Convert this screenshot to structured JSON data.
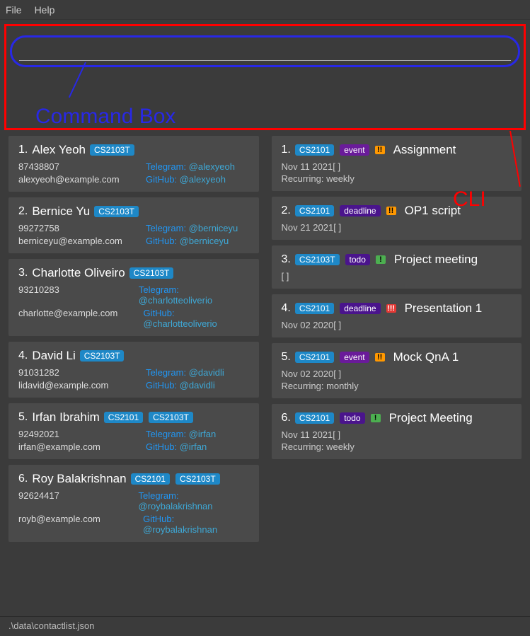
{
  "menu": {
    "file": "File",
    "help": "Help"
  },
  "annotations": {
    "command_box": "Command Box",
    "cli": "CLI"
  },
  "command_input": {
    "value": ""
  },
  "contacts": [
    {
      "idx": "1.",
      "name": "Alex Yeoh",
      "modules": [
        "CS2103T"
      ],
      "phone": "87438807",
      "email": "alexyeoh@example.com",
      "telegram_label": "Telegram:",
      "telegram": "@alexyeoh",
      "github_label": "GitHub:",
      "github": "@alexyeoh"
    },
    {
      "idx": "2.",
      "name": "Bernice Yu",
      "modules": [
        "CS2103T"
      ],
      "phone": "99272758",
      "email": "berniceyu@example.com",
      "telegram_label": "Telegram:",
      "telegram": "@berniceyu",
      "github_label": "GitHub:",
      "github": "@berniceyu"
    },
    {
      "idx": "3.",
      "name": "Charlotte Oliveiro",
      "modules": [
        "CS2103T"
      ],
      "phone": "93210283",
      "email": "charlotte@example.com",
      "telegram_label": "Telegram:",
      "telegram": "@charlotteoliverio",
      "github_label": "GitHub:",
      "github": "@charlotteoliverio"
    },
    {
      "idx": "4.",
      "name": "David Li",
      "modules": [
        "CS2103T"
      ],
      "phone": "91031282",
      "email": "lidavid@example.com",
      "telegram_label": "Telegram:",
      "telegram": "@davidli",
      "github_label": "GitHub:",
      "github": "@davidli"
    },
    {
      "idx": "5.",
      "name": "Irfan Ibrahim",
      "modules": [
        "CS2101",
        "CS2103T"
      ],
      "phone": "92492021",
      "email": "irfan@example.com",
      "telegram_label": "Telegram:",
      "telegram": "@irfan",
      "github_label": "GitHub:",
      "github": "@irfan"
    },
    {
      "idx": "6.",
      "name": "Roy Balakrishnan",
      "modules": [
        "CS2101",
        "CS2103T"
      ],
      "phone": "92624417",
      "email": "royb@example.com",
      "telegram_label": "Telegram:",
      "telegram": "@roybalakrishnan",
      "github_label": "GitHub:",
      "github": "@roybalakrishnan"
    }
  ],
  "tasks": [
    {
      "idx": "1.",
      "module": "CS2101",
      "type": "event",
      "type_label": "event",
      "priority": "!!",
      "priority_color": "orange",
      "name": "Assignment",
      "date": "Nov 11 2021[ ]",
      "recurring": "Recurring: weekly"
    },
    {
      "idx": "2.",
      "module": "CS2101",
      "type": "deadline",
      "type_label": "deadline",
      "priority": "!!",
      "priority_color": "orange",
      "name": "OP1 script",
      "date": "Nov 21 2021[ ]",
      "recurring": ""
    },
    {
      "idx": "3.",
      "module": "CS2103T",
      "type": "todo",
      "type_label": "todo",
      "priority": "!",
      "priority_color": "green",
      "name": "Project meeting",
      "date": "[ ]",
      "recurring": ""
    },
    {
      "idx": "4.",
      "module": "CS2101",
      "type": "deadline",
      "type_label": "deadline",
      "priority": "!!!",
      "priority_color": "red",
      "name": "Presentation 1",
      "date": "Nov 02 2020[ ]",
      "recurring": ""
    },
    {
      "idx": "5.",
      "module": "CS2101",
      "type": "event",
      "type_label": "event",
      "priority": "!!",
      "priority_color": "orange",
      "name": "Mock QnA 1",
      "date": "Nov 02 2020[ ]",
      "recurring": "Recurring: monthly"
    },
    {
      "idx": "6.",
      "module": "CS2101",
      "type": "todo",
      "type_label": "todo",
      "priority": "!",
      "priority_color": "green",
      "name": "Project Meeting",
      "date": "Nov 11 2021[ ]",
      "recurring": "Recurring: weekly"
    }
  ],
  "status": {
    "path": ".\\data\\contactlist.json"
  }
}
